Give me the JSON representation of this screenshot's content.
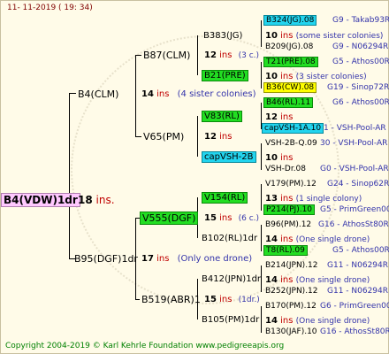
{
  "date": "11- 11-2019 ( 19: 34)",
  "footer": "Copyright 2004-2019 © Karl Kehrle Foundation    www.pedigreeapis.org",
  "root": {
    "name": "B4(VDW)1dr",
    "ins_count": "18",
    "ins_label": "ins."
  },
  "gen1": [
    {
      "name": "B4(CLM)",
      "ins_count": "14",
      "ins_label": "ins",
      "note": "(4 sister colonies)"
    },
    {
      "name": "B95(DGF)1dr",
      "ins_count": "17",
      "ins_label": "ins",
      "note": "(Only one drone)"
    }
  ],
  "gen2": [
    {
      "name": "B87(CLM)",
      "ins_count": "12",
      "ins_label": "ins",
      "note": "(3 c.)"
    },
    {
      "name": "V65(PM)",
      "ins_count": "12",
      "ins_label": "ins",
      "note": ""
    },
    {
      "name": "V555(DGF)",
      "ins_count": "15",
      "ins_label": "ins",
      "note": "(6 c.)"
    },
    {
      "name": "B519(ABR)1",
      "ins_count": "15",
      "ins_label": "ins",
      "note": "(1dr.)"
    }
  ],
  "gen3": [
    {
      "name": "B383(JG)",
      "ins_count": "10",
      "ins_label": "ins",
      "note": "(some sister colonies)"
    },
    {
      "name": "B21(PRE)",
      "ins_count": "10",
      "ins_label": "ins",
      "note": "(3 sister colonies)"
    },
    {
      "name": "V83(RL)",
      "ins_count": "12",
      "ins_label": "ins",
      "note": ""
    },
    {
      "name": "capVSH-2B",
      "ins_count": "10",
      "ins_label": "ins",
      "note": ""
    },
    {
      "name": "V154(RL)",
      "ins_count": "13",
      "ins_label": "ins",
      "note": "(1 single colony)"
    },
    {
      "name": "B102(RL)1dr",
      "ins_count": "14",
      "ins_label": "ins",
      "note": "(One single drone)"
    },
    {
      "name": "B412(JPN)1dr",
      "ins_count": "14",
      "ins_label": "ins",
      "note": "(One single drone)"
    },
    {
      "name": "B105(PM)1dr",
      "ins_count": "14",
      "ins_label": "ins",
      "note": "(One single drone)"
    }
  ],
  "gen4": [
    {
      "name": "B324(JG).08",
      "info": "G9 - Takab93R"
    },
    {
      "name": "B209(JG).08",
      "info": "G9 - N06294R"
    },
    {
      "name": "T21(PRE).08",
      "info": "G5 - Athos00R"
    },
    {
      "name": "B36(CW).08",
      "info": "G19 - Sinop72R"
    },
    {
      "name": "B46(RL).11",
      "info": "G6 - Athos00R"
    },
    {
      "name": "capVSH-1A.10",
      "info": "1 - VSH-Pool-AR"
    },
    {
      "name": "VSH-2B-Q.09",
      "info": "30 - VSH-Pool-AR"
    },
    {
      "name": "VSH-Dr.08",
      "info": "G0 - VSH-Pool-AR"
    },
    {
      "name": "V179(PM).12",
      "info": "G24 - Sinop62R"
    },
    {
      "name": "P214(PJ).10",
      "info": "G5 - PrimGreen00"
    },
    {
      "name": "B96(PM).12",
      "info": "G16 - AthosSt80R"
    },
    {
      "name": "T8(RL).09",
      "info": "G5 - Athos00R"
    },
    {
      "name": "B214(JPN).12",
      "info": "G11 - N06294R"
    },
    {
      "name": "B252(JPN).12",
      "info": "G11 - N06294R"
    },
    {
      "name": "B170(PM).12",
      "info": "G6 - PrimGreen00"
    },
    {
      "name": "B130(JAF).10",
      "info": "G16 - AthosSt80R"
    }
  ]
}
